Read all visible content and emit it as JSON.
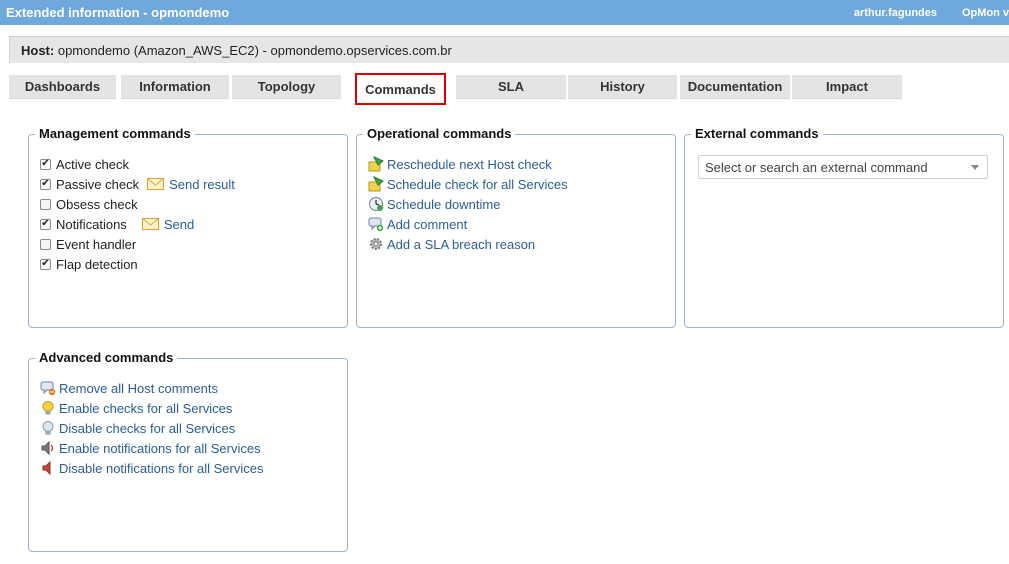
{
  "window": {
    "title": "Extended information - opmondemo",
    "user": "arthur.fagundes",
    "app": "OpMon v"
  },
  "host": {
    "label": "Host:",
    "value": "opmondemo (Amazon_AWS_EC2) - opmondemo.opservices.com.br"
  },
  "tabs": [
    {
      "label": "Dashboards",
      "active": false
    },
    {
      "label": "Information",
      "active": false
    },
    {
      "label": "Topology",
      "active": false
    },
    {
      "label": "Commands",
      "active": true
    },
    {
      "label": "SLA",
      "active": false
    },
    {
      "label": "History",
      "active": false
    },
    {
      "label": "Documentation",
      "active": false
    },
    {
      "label": "Impact",
      "active": false
    }
  ],
  "management": {
    "title": "Management commands",
    "items": [
      {
        "label": "Active check",
        "checked": true
      },
      {
        "label": "Passive check",
        "checked": true,
        "action": "Send result"
      },
      {
        "label": "Obsess check",
        "checked": false
      },
      {
        "label": "Notifications",
        "checked": true,
        "action": "Send"
      },
      {
        "label": "Event handler",
        "checked": false
      },
      {
        "label": "Flap detection",
        "checked": true
      }
    ]
  },
  "operational": {
    "title": "Operational commands",
    "items": [
      {
        "label": "Reschedule next Host check",
        "icon": "reschedule-icon"
      },
      {
        "label": "Schedule check for all Services",
        "icon": "schedule-check-icon"
      },
      {
        "label": "Schedule downtime",
        "icon": "downtime-clock-icon"
      },
      {
        "label": "Add comment",
        "icon": "add-comment-icon"
      },
      {
        "label": "Add a SLA breach reason",
        "icon": "gear-icon"
      }
    ]
  },
  "external": {
    "title": "External commands",
    "placeholder": "Select or search an external command"
  },
  "advanced": {
    "title": "Advanced commands",
    "items": [
      {
        "label": "Remove all Host comments",
        "icon": "remove-comment-icon"
      },
      {
        "label": "Enable checks for all Services",
        "icon": "lightbulb-on-icon"
      },
      {
        "label": "Disable checks for all Services",
        "icon": "lightbulb-off-icon"
      },
      {
        "label": "Enable notifications for all Services",
        "icon": "speaker-on-icon"
      },
      {
        "label": "Disable notifications for all Services",
        "icon": "speaker-off-icon"
      }
    ]
  },
  "colors": {
    "titlebar": "#6fa8dc",
    "link": "#2a5d98",
    "active_tab_border": "#e00000"
  }
}
